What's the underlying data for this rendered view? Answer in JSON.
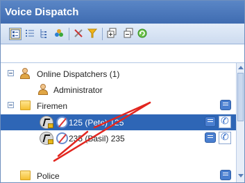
{
  "window": {
    "title": "Voice Dispatch"
  },
  "toolbar": {
    "buttons": [
      {
        "icon": "tree-view-icon",
        "active": true
      },
      {
        "icon": "list-view-icon"
      },
      {
        "icon": "hierarchy-view-icon"
      },
      {
        "icon": "group-users-icon"
      },
      {
        "icon": "tools-icon"
      },
      {
        "icon": "filter-icon"
      },
      {
        "icon": "expand-all-icon"
      },
      {
        "icon": "collapse-all-icon"
      },
      {
        "icon": "refresh-icon"
      }
    ]
  },
  "tree": {
    "online_dispatchers": {
      "label": "Online Dispatchers (1)"
    },
    "administrator": {
      "label": "Administrator"
    },
    "firemen": {
      "label": "Firemen"
    },
    "pete": {
      "label": "125 (Pete) 125"
    },
    "basil": {
      "label": "235 (Basil) 235"
    },
    "police": {
      "label": "Police"
    }
  },
  "annotation_color": "#e2261f",
  "colors": {
    "titlebar": "#4a78bd",
    "selection": "#2e66b6"
  }
}
